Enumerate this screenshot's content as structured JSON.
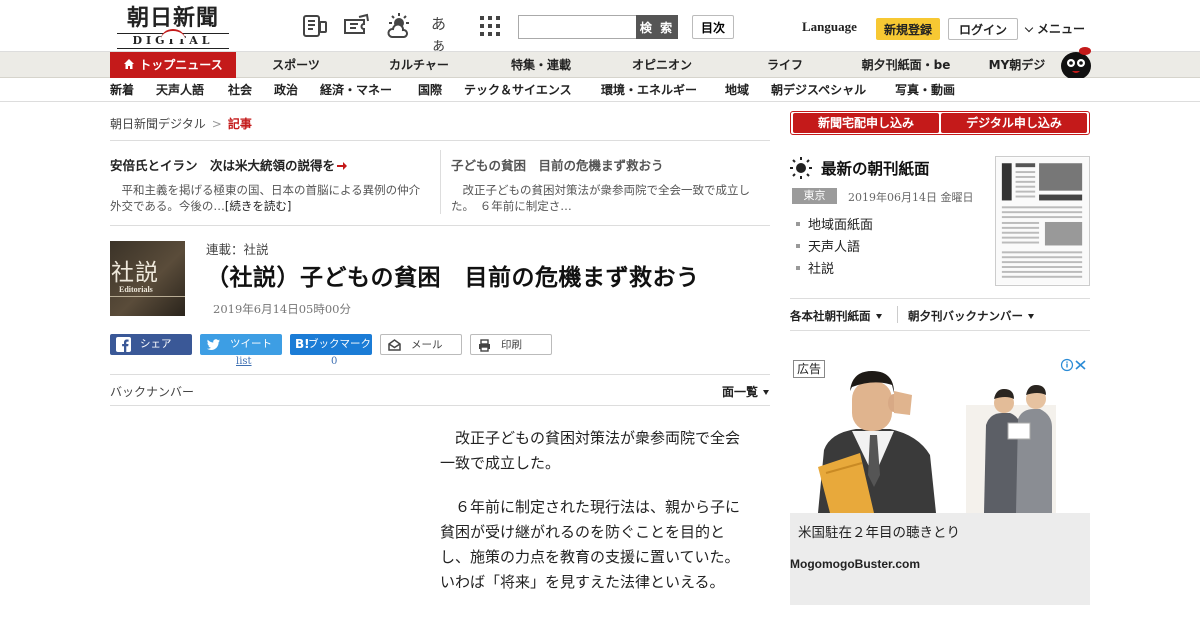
{
  "header": {
    "logo_text": "朝日新聞",
    "logo_sub": "DIGITAL",
    "icons": [
      "news-list-icon",
      "coupon-icon",
      "weather-icon",
      "font-size-icon",
      "grid-menu-icon"
    ],
    "font_icon_text": "あぁ",
    "search_placeholder": "",
    "search_button": "検 索",
    "toc_button": "目次",
    "language": "Language",
    "register": "新規登録",
    "login": "ログイン",
    "menu": "メニュー"
  },
  "nav_primary": [
    "トップニュース",
    "スポーツ",
    "カルチャー",
    "特集・連載",
    "オピニオン",
    "ライフ",
    "朝夕刊紙面・be",
    "MY朝デジ"
  ],
  "nav_secondary": [
    "新着",
    "天声人語",
    "社会",
    "政治",
    "経済・マネー",
    "国際",
    "テック＆サイエンス",
    "環境・エネルギー",
    "地域",
    "朝デジスペシャル",
    "写真・動画"
  ],
  "breadcrumb": {
    "home": "朝日新聞デジタル",
    "separator": ">",
    "current": "記事"
  },
  "related": [
    {
      "title": "安倍氏とイラン　次は米大統領の説得を",
      "excerpt": "平和主義を掲げる極東の国、日本の首脳による異例の仲介外交である。今後の…",
      "more": "[続きを読む]"
    },
    {
      "title": "子どもの貧困　目前の危機まず救おう",
      "excerpt": "改正子どもの貧困対策法が衆参両院で全会一致で成立した。　６年前に制定さ…"
    }
  ],
  "article": {
    "thumb_kanji": "社説",
    "thumb_english": "Editorials",
    "series": "連載：社説",
    "headline": "（社説）子どもの貧困　目前の危機まず救おう",
    "date": "2019年6月14日05時00分",
    "paragraphs": [
      "改正子どもの貧困対策法が衆参両院で全会一致で成立した。",
      "６年前に制定された現行法は、親から子に貧困が受け継がれるのを防ぐことを目的とし、施策の力点を教育の支援に置いていた。いわば「将来」を見すえた法律といえる。"
    ]
  },
  "share": {
    "facebook": "シェア",
    "twitter": "ツイート",
    "twitter_count": "list",
    "hatena_icon": "B!",
    "hatena": "ブックマーク",
    "hatena_count": "0",
    "mail": "メール",
    "print": "印刷"
  },
  "backnumber": {
    "label": "バックナンバー",
    "page_list": "面一覧"
  },
  "sidebar": {
    "subscribe_paper": "新聞宅配申し込み",
    "subscribe_digital": "デジタル申し込み",
    "paper_title": "最新の朝刊紙面",
    "region": "東京",
    "paper_date": "2019年06月14日 金曜日",
    "links": [
      "地域面紙面",
      "天声人語",
      "社説"
    ],
    "tab_regional": "各本社朝刊紙面",
    "tab_backnumber": "朝夕刊バックナンバー"
  },
  "ad": {
    "label": "広告",
    "title": "米国駐在２年目の聴きとり",
    "domain": "MogomogoBuster.com"
  },
  "colors": {
    "brand_red": "#c41a1a",
    "register_yellow": "#f7c833",
    "facebook": "#3a5897",
    "twitter": "#3d9ee4",
    "hatena": "#1b7cd6"
  }
}
